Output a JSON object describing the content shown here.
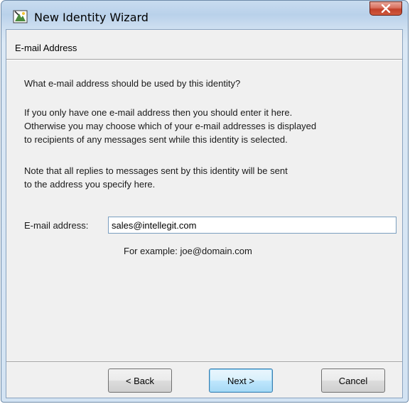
{
  "window": {
    "title": "New Identity Wizard",
    "close_glyph": "X",
    "app_icon": "wizard-icon"
  },
  "page": {
    "header": "E-mail Address",
    "question": "What e-mail address should be used by this identity?",
    "info_lines": [
      "If you only have one e-mail address then you should enter it here.",
      "Otherwise you may choose which of your e-mail addresses is displayed",
      "to recipients of any messages sent while this identity is selected."
    ],
    "note_lines": [
      "Note that all replies to messages sent by this identity will be sent",
      "to the address you specify here."
    ],
    "email_label": "E-mail address:",
    "email_value": "sales@intellegit.com",
    "example": "For example: joe@domain.com"
  },
  "buttons": {
    "back": "< Back",
    "next": "Next >",
    "cancel": "Cancel"
  },
  "colors": {
    "accent": "#3c7fb1",
    "close": "#c2402a",
    "frame": "#b9d1ea"
  }
}
